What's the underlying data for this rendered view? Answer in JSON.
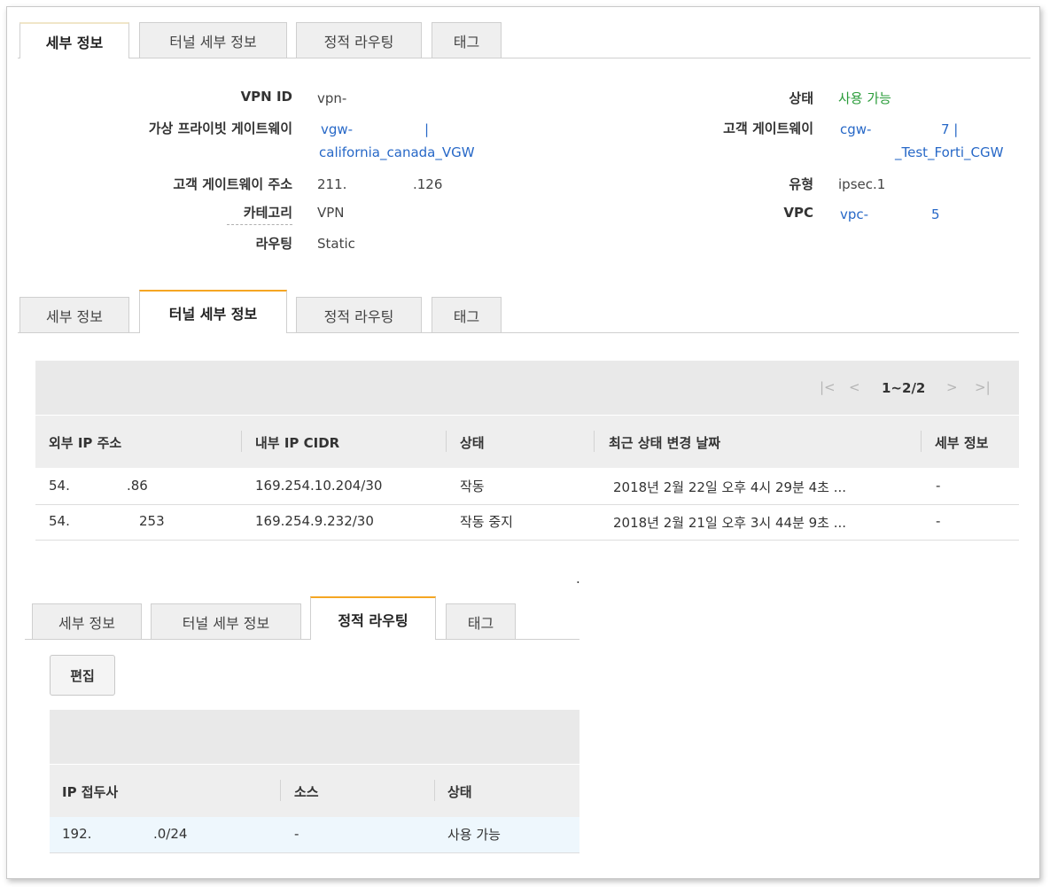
{
  "tabs": [
    "세부 정보",
    "터널 세부 정보",
    "정적 라우팅",
    "태그"
  ],
  "details": {
    "vpn_id_label": "VPN ID",
    "vpn_id": "vpn-",
    "vgw_label": "가상 프라이빗 게이트웨이",
    "vgw_line1": "vgw-",
    "vgw_sep": "|",
    "vgw_line2": "california_canada_VGW",
    "cgw_addr_label": "고객 게이트웨이 주소",
    "cgw_addr_a": "211.",
    "cgw_addr_b": ".126",
    "category_label": "카테고리",
    "category": "VPN",
    "routing_label": "라우팅",
    "routing": "Static",
    "state_label": "상태",
    "state": "사용 가능",
    "cgw_label": "고객 게이트웨이",
    "cgw_line1": "cgw-",
    "cgw_line1b": "7 |",
    "cgw_line2": "_Test_Forti_CGW",
    "type_label": "유형",
    "type": "ipsec.1",
    "vpc_label": "VPC",
    "vpc_a": "vpc-",
    "vpc_b": "5"
  },
  "tunnel": {
    "pager": {
      "first": "|<",
      "prev": "<",
      "range": "1~2/2",
      "next": ">",
      "last": ">|"
    },
    "columns": [
      "외부 IP 주소",
      "내부 IP CIDR",
      "상태",
      "최근 상태 변경 날짜",
      "세부 정보"
    ],
    "rows": [
      {
        "ip_a": "54.",
        "ip_b": ".86",
        "cidr": "169.254.10.204/30",
        "status": "작동",
        "status_color": "#2a9c3a",
        "date": "2018년 2월 22일 오후 4시 29분 4초 ...",
        "detail": "-"
      },
      {
        "ip_a": "54.",
        "ip_b": "253",
        "cidr": "169.254.9.232/30",
        "status": "작동 중지",
        "status_color": "#d0191b",
        "date": "2018년 2월 21일 오후 3시 44분 9초 ...",
        "detail": "-"
      }
    ],
    "dot": "."
  },
  "static": {
    "edit_label": "편집",
    "columns": [
      "IP 접두사",
      "소스",
      "상태"
    ],
    "row": {
      "prefix_a": "192.",
      "prefix_b": ".0/24",
      "source": "-",
      "status": "사용 가능"
    }
  },
  "colors": {
    "accent_orange": "#f5a623",
    "link_blue": "#2768c7",
    "ok_green": "#2a9c3a",
    "down_red": "#d0191b"
  }
}
